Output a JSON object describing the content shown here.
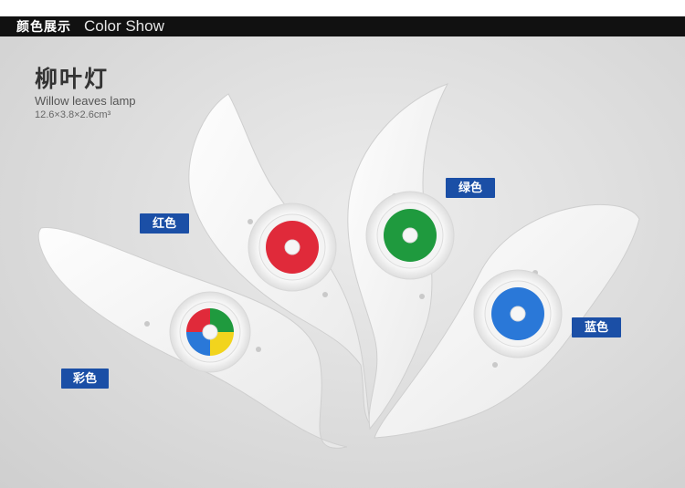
{
  "header": {
    "title_cn": "颜色展示",
    "title_en": "Color Show"
  },
  "product": {
    "name_cn": "柳叶灯",
    "name_en": "Willow leaves lamp",
    "size": "12.6×3.8×2.6cm³"
  },
  "labels": {
    "red": "红色",
    "green": "绿色",
    "blue": "蓝色",
    "multicolor": "彩色"
  },
  "colors": {
    "label_bg": "#1b4fa6",
    "led_red": "#e02a3a",
    "led_green": "#1f9a3e",
    "led_blue": "#2a78d8",
    "led_multi": [
      "#e02a3a",
      "#1f9a3e",
      "#f2d41d",
      "#2a78d8"
    ]
  }
}
